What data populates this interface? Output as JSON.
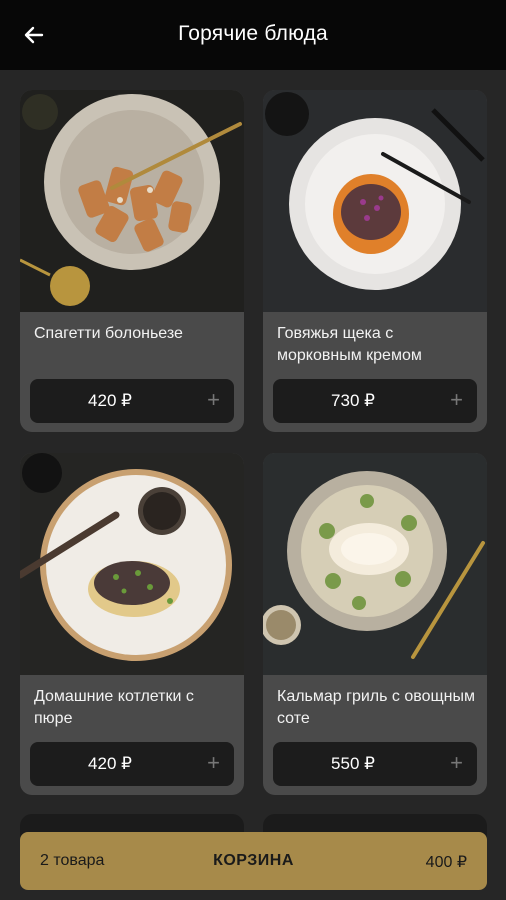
{
  "header": {
    "title": "Горячие блюда"
  },
  "products": [
    {
      "name": "Спагетти болоньезе",
      "price": "420 ₽",
      "add": "+"
    },
    {
      "name": "Говяжья щека с морковным кремом",
      "price": "730 ₽",
      "add": "+"
    },
    {
      "name": "Домашние котлетки с пюре",
      "price": "420 ₽",
      "add": "+"
    },
    {
      "name": "Кальмар гриль с овощным соте",
      "price": "550 ₽",
      "add": "+"
    }
  ],
  "cart": {
    "count": "2 товара",
    "label": "КОРЗИНА",
    "total": "400 ₽"
  },
  "colors": {
    "appbar": "#070707",
    "background": "#262626",
    "card": "#4a4a4a",
    "cart": "#a78a4a"
  }
}
